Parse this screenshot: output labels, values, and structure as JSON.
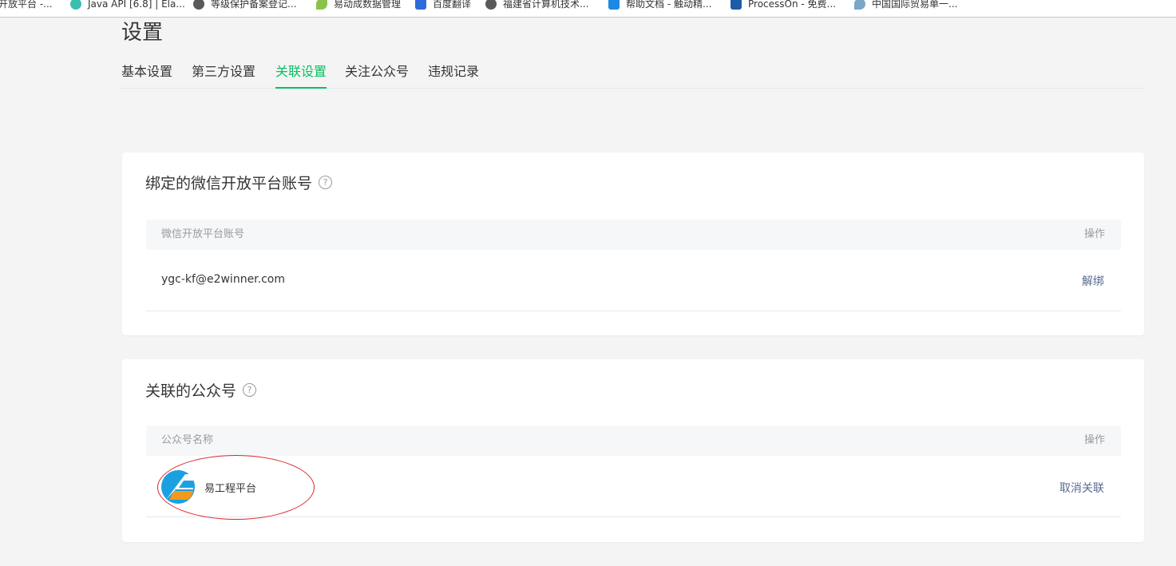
{
  "bookmarks": [
    {
      "label": "开放平台 -...",
      "color": "#ffffff"
    },
    {
      "label": "Java API [6.8] | Ela...",
      "color": "#3cbfae"
    },
    {
      "label": "等级保护备案登记...",
      "color": "#5a5a5a"
    },
    {
      "label": "易动成数据管理",
      "color": "#8bc34a"
    },
    {
      "label": "百度翻译",
      "color": "#2f6bd8"
    },
    {
      "label": "福建省计算机技术...",
      "color": "#5a5a5a"
    },
    {
      "label": "帮助文档 - 触动精...",
      "color": "#1e88e5"
    },
    {
      "label": "ProcessOn - 免费...",
      "color": "#1e5ba8"
    },
    {
      "label": "中国国际贸易单一...",
      "color": "#7aa7c7"
    }
  ],
  "page": {
    "title": "设置"
  },
  "tabs": [
    "基本设置",
    "第三方设置",
    "关联设置",
    "关注公众号",
    "违规记录"
  ],
  "active_tab": "关联设置",
  "open_platform": {
    "title": "绑定的微信开放平台账号",
    "help": "?",
    "col_account": "微信开放平台账号",
    "col_action": "操作",
    "account": "ygc-kf@e2winner.com",
    "action": "解绑"
  },
  "official_accounts": {
    "title": "关联的公众号",
    "help": "?",
    "col_name": "公众号名称",
    "col_action": "操作",
    "name": "易工程平台",
    "action": "取消关联"
  },
  "colors": {
    "accent": "#07c160",
    "link": "#576b95",
    "annotation": "#d9262c"
  }
}
